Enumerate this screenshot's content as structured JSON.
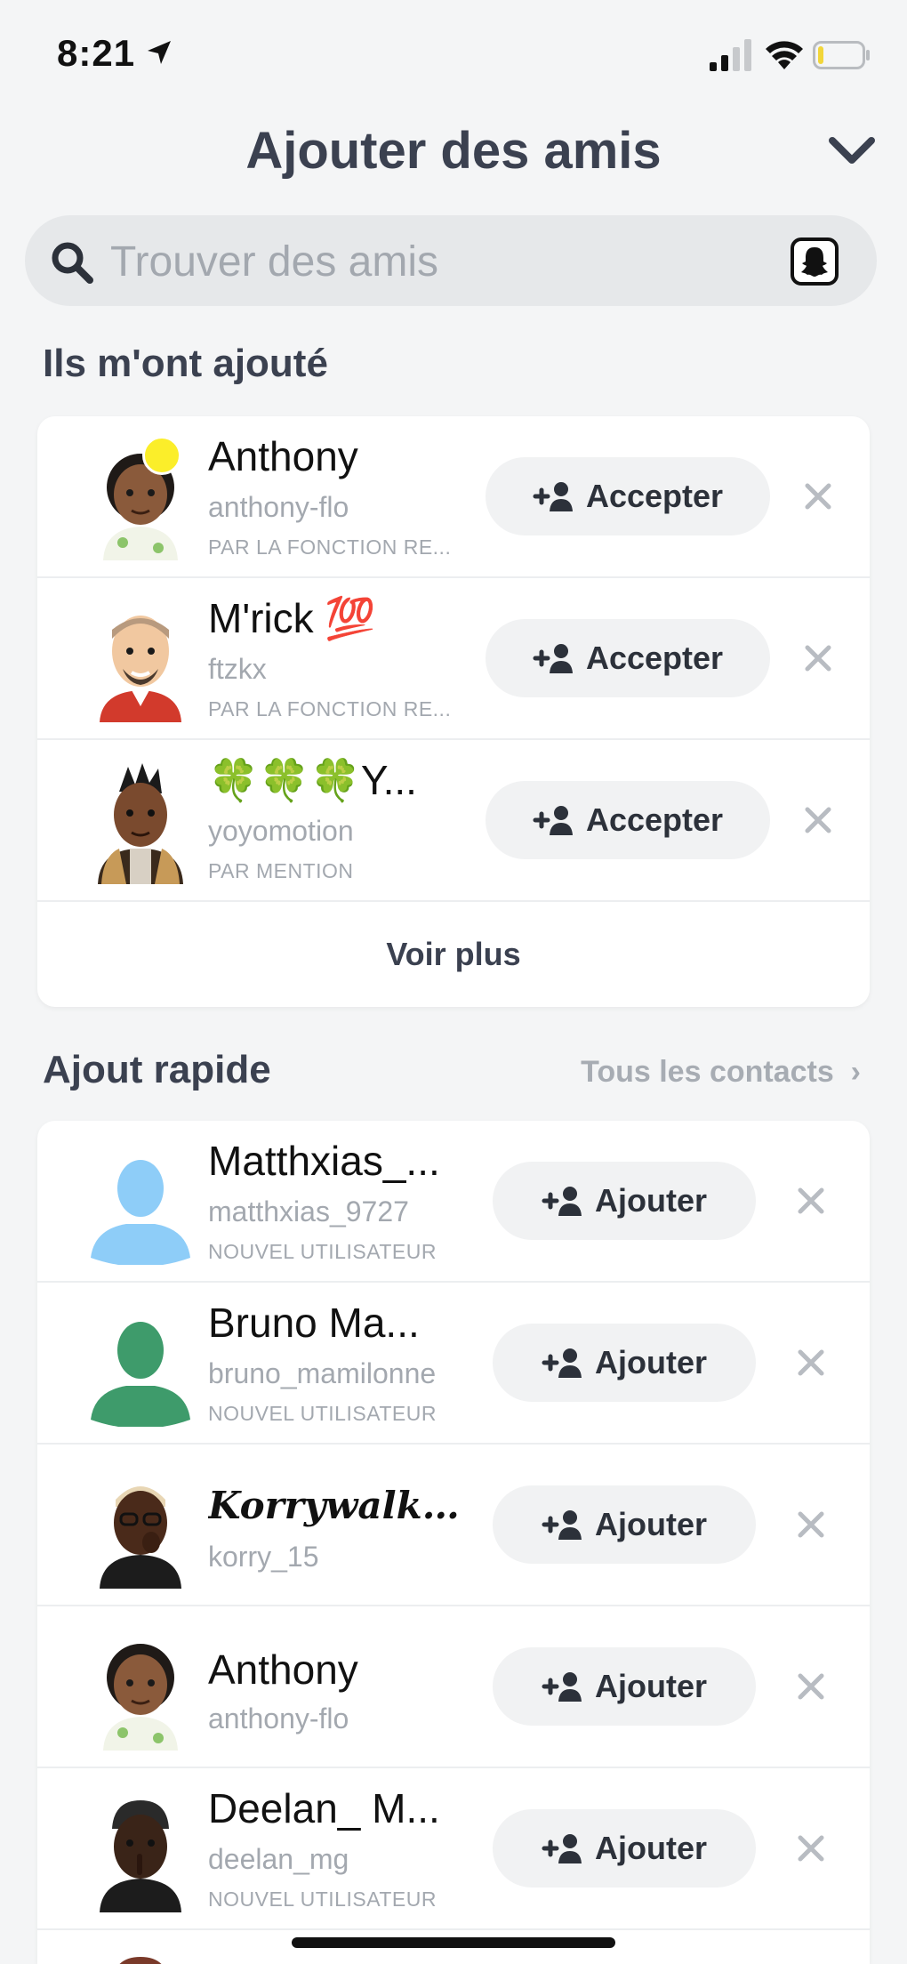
{
  "status_bar": {
    "time": "8:21"
  },
  "header": {
    "title": "Ajouter des amis"
  },
  "search": {
    "placeholder": "Trouver des amis"
  },
  "added_me": {
    "title": "Ils m'ont ajouté",
    "rows": [
      {
        "name": "Anthony",
        "username": "anthony-flo",
        "reason": "PAR LA FONCTION RE...",
        "action": "Accepter",
        "new_badge": true
      },
      {
        "name": "M'rick 💯",
        "username": "ftzkx",
        "reason": "PAR LA FONCTION RE...",
        "action": "Accepter"
      },
      {
        "name": "🍀🍀🍀Y...",
        "username": "yoyomotion",
        "reason": "PAR MENTION",
        "action": "Accepter"
      }
    ],
    "see_more": "Voir plus"
  },
  "quick_add": {
    "title": "Ajout rapide",
    "all_contacts": "Tous les contacts",
    "rows": [
      {
        "name": "Matthxias_...",
        "username": "matthxias_9727",
        "reason": "NOUVEL UTILISATEUR",
        "action": "Ajouter",
        "avatar": "silhouette",
        "avatar_color": "#8ecdf8"
      },
      {
        "name": "Bruno Ma...",
        "username": "bruno_mamilonne",
        "reason": "NOUVEL UTILISATEUR",
        "action": "Ajouter",
        "avatar": "silhouette",
        "avatar_color": "#3e9b6b"
      },
      {
        "name": "Korrywalker...",
        "username": "korry_15",
        "reason": "",
        "action": "Ajouter"
      },
      {
        "name": "Anthony",
        "username": "anthony-flo",
        "reason": "",
        "action": "Ajouter"
      },
      {
        "name": "Deelan_ M...",
        "username": "deelan_mg",
        "reason": "NOUVEL UTILISATEUR",
        "action": "Ajouter"
      }
    ]
  }
}
